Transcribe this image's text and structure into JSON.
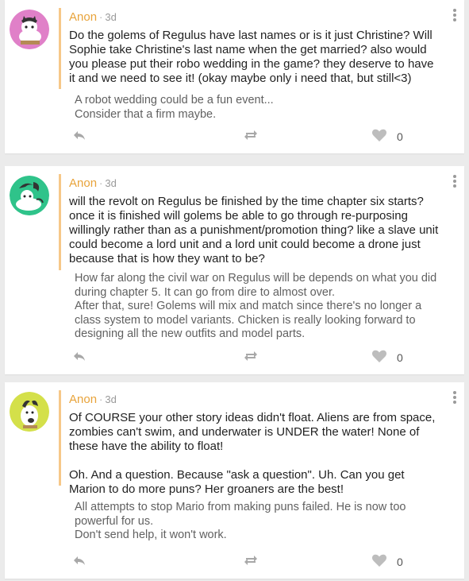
{
  "posts": [
    {
      "author": "Anon",
      "separator": "·",
      "time": "3d",
      "question": "Do the golems of Regulus have last names or is it just Christine? Will Sophie take Christine's last name when the get married? also would you please put their robo wedding in the game? they deserve to have it and we need to see it! (okay maybe only i need that, but still<3)",
      "answer": "A robot wedding could be a fun event...\nConsider that a firm maybe.",
      "likes": "0",
      "avatar_color": "#e080c8"
    },
    {
      "author": "Anon",
      "separator": "·",
      "time": "3d",
      "question": "will the revolt on Regulus be finished by the time chapter six starts? once it is finished will golems be able to go through  re-purposing willingly rather than as a punishment/promotion thing? like a slave unit could become a lord unit and a lord unit could become a drone just because that is how they want to be?",
      "answer": "How far along the civil war on Regulus will be depends on what you did during chapter 5. It can go from dire to almost over.\nAfter that, sure! Golems will mix and match since there's no longer a class system to model variants. Chicken is really looking forward to designing all the new outfits and model parts.",
      "likes": "0",
      "avatar_color": "#2fc38a"
    },
    {
      "author": "Anon",
      "separator": "·",
      "time": "3d",
      "question": "Of COURSE your other story ideas didn't float. Aliens are from space, zombies can't swim, and underwater is UNDER the water! None of these have the ability to float!\n\nOh. And a question. Because \"ask a question\". Uh. Can you get Marion to do more puns? Her groaners are the best!",
      "answer": "All attempts to stop Mario from making puns failed. He is now too powerful for us.\nDon't send help, it won't work.",
      "likes": "0",
      "avatar_color": "#d4e04a"
    }
  ],
  "icons": {
    "reply": "reply-icon",
    "reblog": "reblog-icon",
    "like": "heart-icon",
    "menu": "more-vertical-icon"
  }
}
